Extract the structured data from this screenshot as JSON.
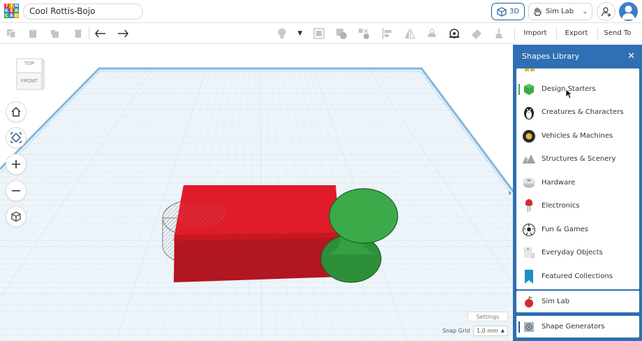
{
  "topbar": {
    "logo_letters": [
      "T",
      "I",
      "N",
      "K",
      "E",
      "R",
      "C",
      "A",
      "D"
    ],
    "project_title": "Cool Rottis-Bojo",
    "view_mode_label": "3D",
    "sim_lab_label": "Sim Lab"
  },
  "toolbar": {
    "import_label": "Import",
    "export_label": "Export",
    "send_to_label": "Send To"
  },
  "viewcube": {
    "top_label": "TOP",
    "front_label": "FRONT"
  },
  "workplane": {
    "settings_label": "Settings",
    "snap_grid_label": "Snap Grid",
    "snap_grid_value": "1.0 mm"
  },
  "shapes_library": {
    "title": "Shapes Library",
    "items": [
      {
        "label": "Design Starters",
        "icon": "green-cube-icon"
      },
      {
        "label": "Creatures & Characters",
        "icon": "penguin-icon"
      },
      {
        "label": "Vehicles & Machines",
        "icon": "wheel-icon"
      },
      {
        "label": "Structures & Scenery",
        "icon": "rocks-icon"
      },
      {
        "label": "Hardware",
        "icon": "nut-icon"
      },
      {
        "label": "Electronics",
        "icon": "led-icon"
      },
      {
        "label": "Fun & Games",
        "icon": "soccer-ball-icon"
      },
      {
        "label": "Everyday Objects",
        "icon": "toilet-paper-icon"
      },
      {
        "label": "Featured Collections",
        "icon": "bookmark-icon"
      }
    ],
    "sim_lab_label": "Sim Lab",
    "shape_generators_label": "Shape Generators"
  },
  "colors": {
    "accent_blue": "#2f6fb3",
    "box_red": "#e01c2a",
    "shape_green": "#3aab48",
    "grid_line": "#d9e8f3"
  }
}
